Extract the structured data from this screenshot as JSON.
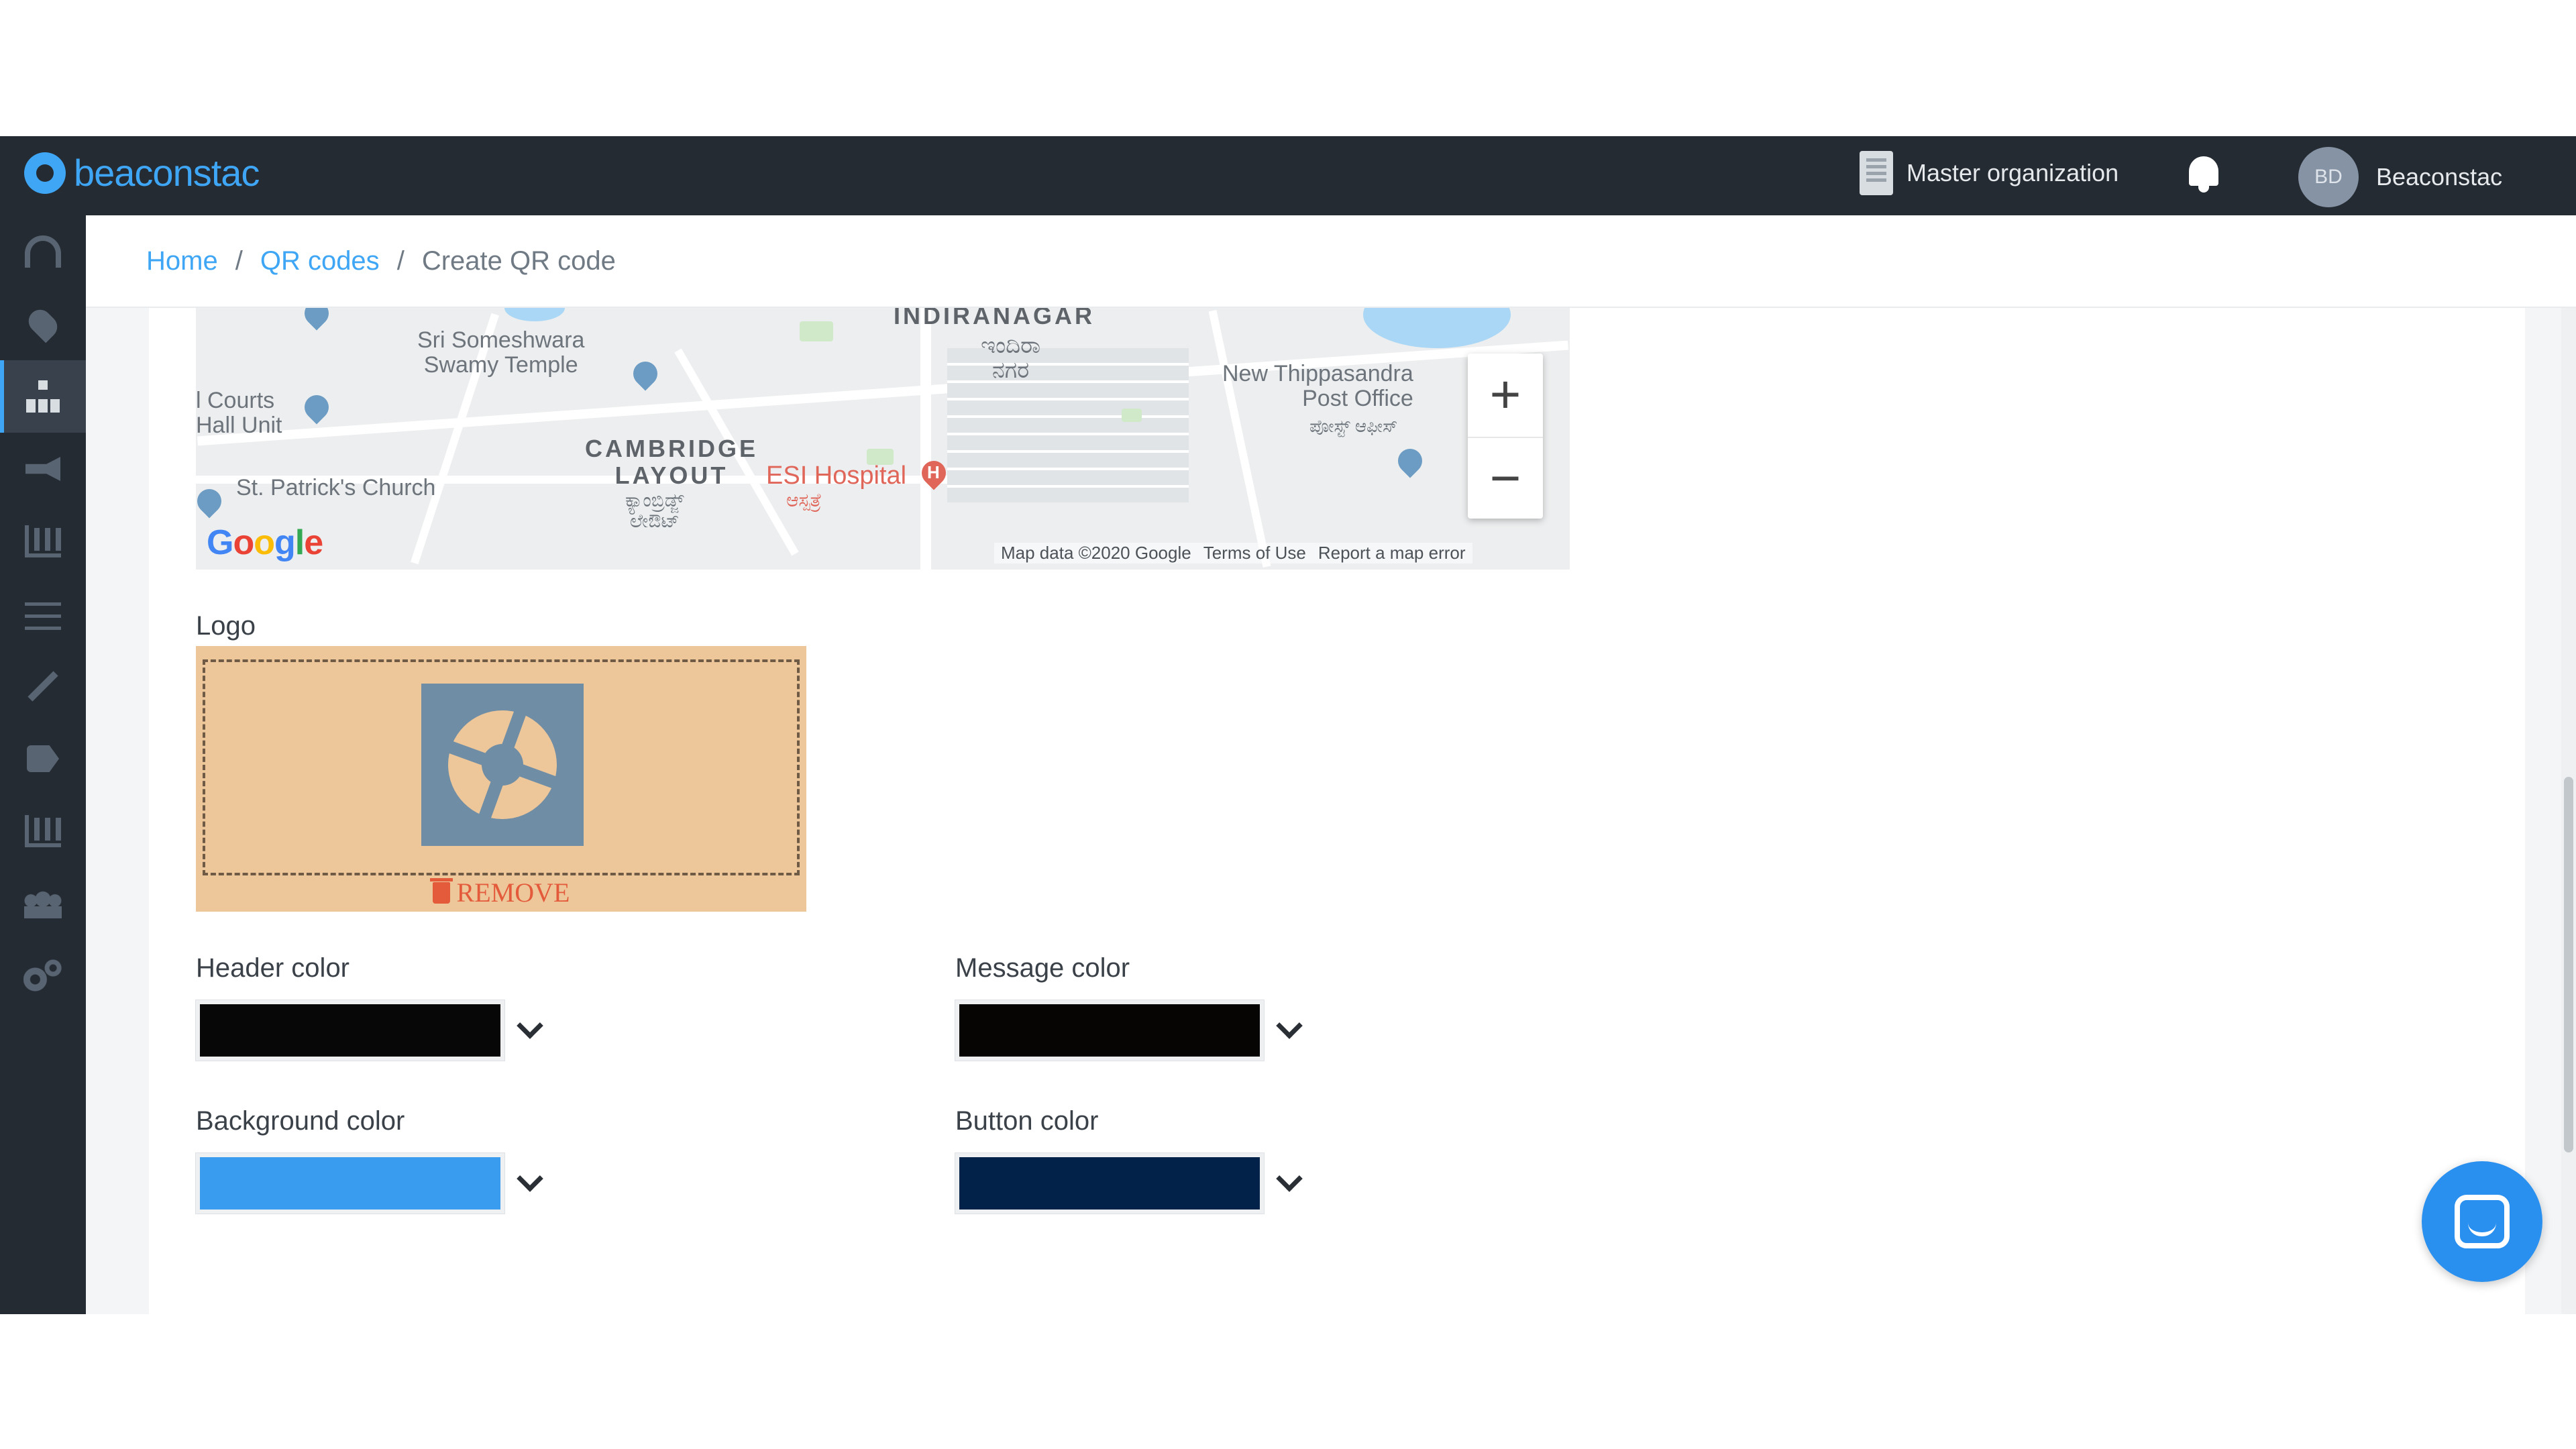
{
  "header": {
    "brand": "beaconstac",
    "org_label": "Master organization",
    "user_initials": "BD",
    "user_name": "Beaconstac"
  },
  "sidebar": {
    "items": [
      {
        "icon": "dashboard-icon",
        "active": false
      },
      {
        "icon": "location-pin-icon",
        "active": false
      },
      {
        "icon": "sitemap-icon",
        "active": true
      },
      {
        "icon": "megaphone-icon",
        "active": false
      },
      {
        "icon": "analytics-icon",
        "active": false
      },
      {
        "icon": "sliders-icon",
        "active": false
      },
      {
        "icon": "magic-wand-icon",
        "active": false
      },
      {
        "icon": "tags-icon",
        "active": false
      },
      {
        "icon": "reports-icon",
        "active": false
      },
      {
        "icon": "users-icon",
        "active": false
      },
      {
        "icon": "settings-cogs-icon",
        "active": false
      }
    ]
  },
  "breadcrumb": {
    "home": "Home",
    "qr_codes": "QR codes",
    "current": "Create QR code",
    "separator": "/"
  },
  "map": {
    "labels": {
      "indiranagar": "INDIRANAGAR",
      "indiranagar_local": "ಇಂದಿರಾ\nನಗರ",
      "someshwara": "Sri Someshwara\nSwamy Temple",
      "courts": "l Courts\nHall Unit",
      "cambridge": "CAMBRIDGE\nLAYOUT",
      "cambridge_local": "ಕ್ಯಾಂಬ್ರಿಡ್ಜ್\nಲೇಔಟ್",
      "thippasandra": "New Thippasandra\nPost Office",
      "thippasandra_local": "ಪೋಸ್ಟ್ ಆಫೀಸ್",
      "stpatricks": "St. Patrick's Church",
      "esi": "ESI Hospital",
      "esi_local": "ಆಸ್ಪತ್ರೆ"
    },
    "google": "Google",
    "attribution": {
      "map_data": "Map data ©2020 Google",
      "terms": "Terms of Use",
      "report": "Report a map error"
    },
    "zoom_in": "+",
    "zoom_out": "−"
  },
  "logo_section": {
    "label": "Logo",
    "remove_label": "REMOVE"
  },
  "colors": {
    "header": {
      "label": "Header color",
      "value": "#070707"
    },
    "message": {
      "label": "Message color",
      "value": "#070404"
    },
    "background": {
      "label": "Background color",
      "value": "#3a9cef"
    },
    "button": {
      "label": "Button color",
      "value": "#03224a"
    }
  },
  "accent_color": "#3ea6f4"
}
